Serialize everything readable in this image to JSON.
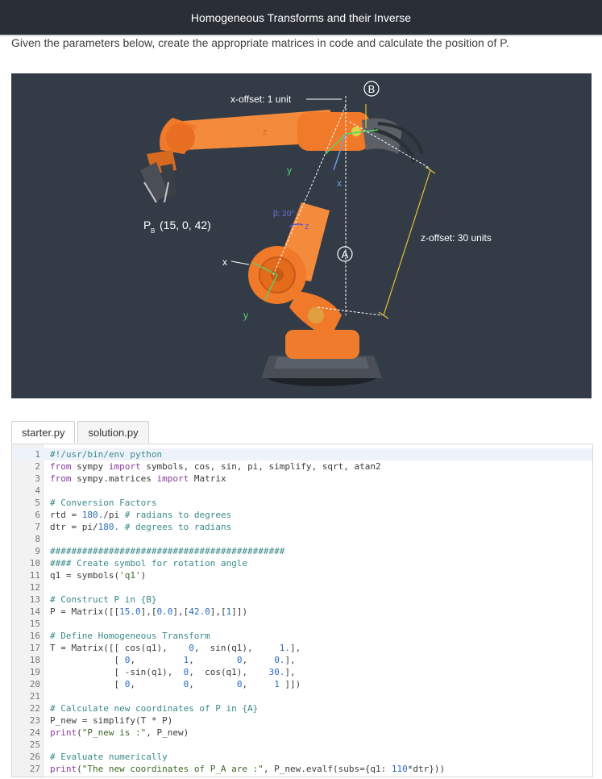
{
  "header": {
    "title": "Homogeneous Transforms and their Inverse"
  },
  "instructions": "Given the parameters below, create the appropriate matrices in code and calculate the position of P.",
  "figure": {
    "x_offset_label": "x-offset: 1 unit",
    "z_offset_label": "z-offset: 30 units",
    "frame_b_label": "B",
    "frame_a_label": "A",
    "point_label_p": "P",
    "point_label_sub": "B",
    "point_coords": "(15, 0, 42)",
    "angle_label": "β: 20°",
    "axis_x_upper": "x",
    "axis_y_upper": "y",
    "axis_z_upper": "z",
    "axis_x_lower": "x",
    "axis_y_lower": "y",
    "axis_z_lower": "z",
    "colors": {
      "background": "#333b46",
      "robot": "#f07a2a",
      "guide": "#e2c23a",
      "axis": "#7fa8d8"
    }
  },
  "tabs": [
    {
      "label": "starter.py",
      "active": true
    },
    {
      "label": "solution.py",
      "active": false
    }
  ],
  "code_lines": [
    [
      [
        "#!/usr/bin/env python",
        "comment"
      ]
    ],
    [
      [
        "from ",
        "kw"
      ],
      [
        "sympy ",
        "plain"
      ],
      [
        "import ",
        "kw"
      ],
      [
        "symbols, cos, sin, pi, simplify, sqrt, atan2",
        "plain"
      ]
    ],
    [
      [
        "from ",
        "kw"
      ],
      [
        "sympy.matrices ",
        "plain"
      ],
      [
        "import ",
        "kw"
      ],
      [
        "Matrix",
        "plain"
      ]
    ],
    [],
    [
      [
        "# Conversion Factors",
        "comment"
      ]
    ],
    [
      [
        "rtd = ",
        "plain"
      ],
      [
        "180.",
        "num"
      ],
      [
        "/pi ",
        "plain"
      ],
      [
        "# radians to degrees",
        "comment"
      ]
    ],
    [
      [
        "dtr = pi/",
        "plain"
      ],
      [
        "180.",
        "num"
      ],
      [
        " ",
        "plain"
      ],
      [
        "# degrees to radians",
        "comment"
      ]
    ],
    [],
    [
      [
        "############################################",
        "comment"
      ]
    ],
    [
      [
        "#### Create symbol for rotation angle",
        "comment"
      ]
    ],
    [
      [
        "q1 = symbols(",
        "plain"
      ],
      [
        "'q1'",
        "str"
      ],
      [
        ")",
        "plain"
      ]
    ],
    [],
    [
      [
        "# Construct P in {B}",
        "comment"
      ]
    ],
    [
      [
        "P = Matrix([[",
        "plain"
      ],
      [
        "15.0",
        "num"
      ],
      [
        "],[",
        "plain"
      ],
      [
        "0.0",
        "num"
      ],
      [
        "],[",
        "plain"
      ],
      [
        "42.0",
        "num"
      ],
      [
        "],[",
        "plain"
      ],
      [
        "1",
        "num"
      ],
      [
        "]])",
        "plain"
      ]
    ],
    [],
    [
      [
        "# Define Homogeneous Transform",
        "comment"
      ]
    ],
    [
      [
        "T = Matrix([[ cos(q1),    ",
        "plain"
      ],
      [
        "0",
        "num"
      ],
      [
        ",  sin(q1),     ",
        "plain"
      ],
      [
        "1.",
        "num"
      ],
      [
        "],",
        "plain"
      ]
    ],
    [
      [
        "            [ ",
        "plain"
      ],
      [
        "0",
        "num"
      ],
      [
        ",         ",
        "plain"
      ],
      [
        "1",
        "num"
      ],
      [
        ",        ",
        "plain"
      ],
      [
        "0",
        "num"
      ],
      [
        ",     ",
        "plain"
      ],
      [
        "0.",
        "num"
      ],
      [
        "],",
        "plain"
      ]
    ],
    [
      [
        "            [ -sin(q1),  ",
        "plain"
      ],
      [
        "0",
        "num"
      ],
      [
        ",  cos(q1),    ",
        "plain"
      ],
      [
        "30.",
        "num"
      ],
      [
        "],",
        "plain"
      ]
    ],
    [
      [
        "            [ ",
        "plain"
      ],
      [
        "0",
        "num"
      ],
      [
        ",         ",
        "plain"
      ],
      [
        "0",
        "num"
      ],
      [
        ",        ",
        "plain"
      ],
      [
        "0",
        "num"
      ],
      [
        ",     ",
        "plain"
      ],
      [
        "1",
        "num"
      ],
      [
        " ]])",
        "plain"
      ]
    ],
    [],
    [
      [
        "# Calculate new coordinates of P in {A}",
        "comment"
      ]
    ],
    [
      [
        "P_new = simplify(T * P)",
        "plain"
      ]
    ],
    [
      [
        "print",
        "kw"
      ],
      [
        "(",
        "plain"
      ],
      [
        "\"P_new is :\"",
        "str"
      ],
      [
        ", P_new)",
        "plain"
      ]
    ],
    [],
    [
      [
        "# Evaluate numerically",
        "comment"
      ]
    ],
    [
      [
        "print",
        "kw"
      ],
      [
        "(",
        "plain"
      ],
      [
        "\"The new coordinates of P_A are :\"",
        "str"
      ],
      [
        ", P_new.evalf(subs={q1: ",
        "plain"
      ],
      [
        "110",
        "num"
      ],
      [
        "*dtr}))",
        "plain"
      ]
    ]
  ]
}
